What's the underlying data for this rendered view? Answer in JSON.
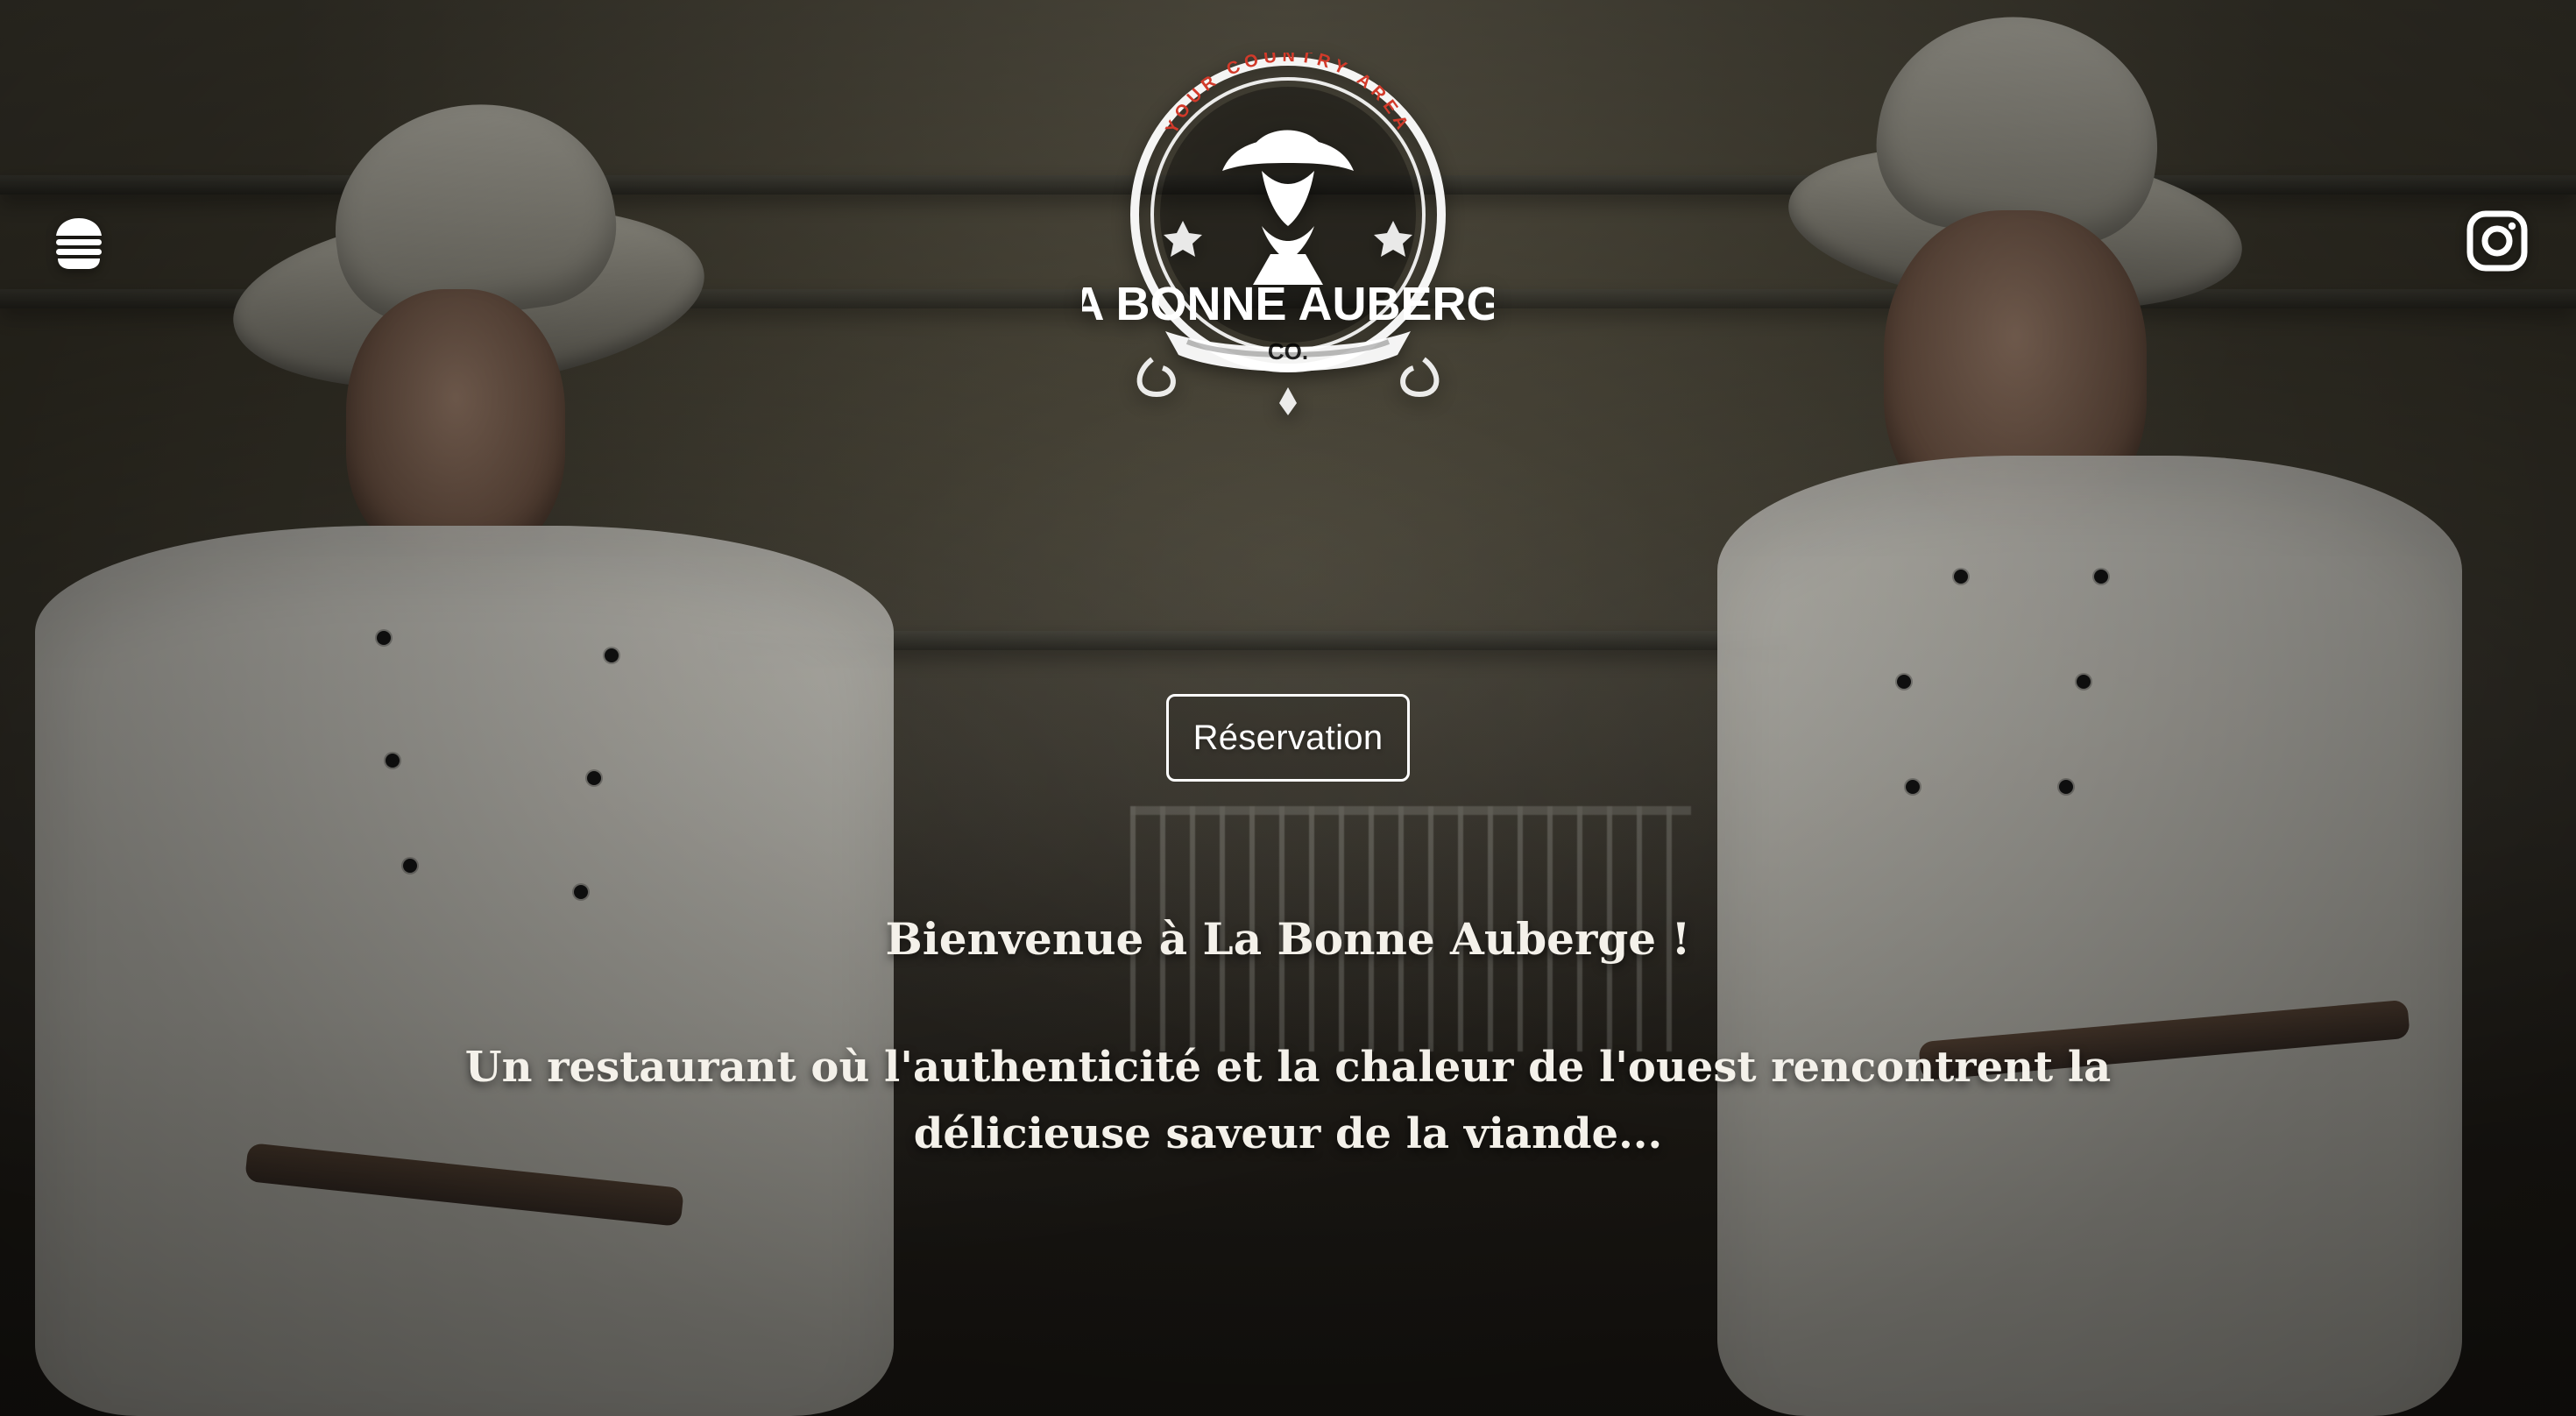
{
  "brand": {
    "arc_text": "YOUR COUNTRY AREA",
    "name": "LA BONNE AUBERGE",
    "suffix": "CO."
  },
  "header": {
    "left_icon": "burger-menu-icon",
    "right_icon": "instagram-icon"
  },
  "cta": {
    "reservation_label": "Réservation"
  },
  "hero": {
    "welcome": "Bienvenue à La Bonne Auberge !",
    "tagline": "Un restaurant où l'authenticité et la chaleur de l'ouest rencontrent la délicieuse saveur de la viande..."
  },
  "colors": {
    "logo_white": "#ffffff",
    "logo_accent": "#d23a2a"
  }
}
